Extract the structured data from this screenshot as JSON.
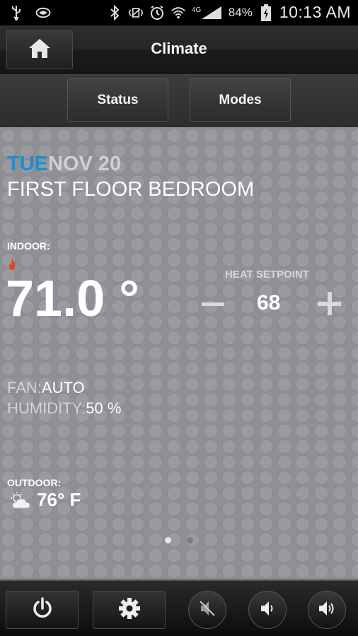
{
  "status_bar": {
    "icons": [
      "usb-icon",
      "sync-icon",
      "bluetooth-icon",
      "vibrate-icon",
      "alarm-icon",
      "wifi-icon",
      "4g-icon",
      "signal-icon"
    ],
    "battery_text": "84%",
    "time": "10:13 AM"
  },
  "header": {
    "title": "Climate",
    "home_icon": "home-icon"
  },
  "tabs": [
    {
      "label": "Status"
    },
    {
      "label": "Modes"
    }
  ],
  "climate": {
    "day": "TUE",
    "date": "NOV 20",
    "room": "FIRST FLOOR BEDROOM",
    "indoor_label": "INDOOR:",
    "indoor_temp": "71.0 °",
    "setpoint_label": "HEAT SETPOINT",
    "setpoint_value": "68",
    "fan_label": "FAN:",
    "fan_value": "AUTO",
    "humidity_label": "HUMIDITY:",
    "humidity_value": "50 %",
    "outdoor_label": "OUTDOOR:",
    "outdoor_temp": "76° F",
    "mode_icon": "flame-icon",
    "weather_icon": "partly-cloudy-icon"
  },
  "pager": {
    "pages": 2,
    "active": 1
  },
  "bottom_bar": {
    "icons": [
      "power-icon",
      "gear-icon",
      "mute-icon",
      "volume-down-icon",
      "volume-up-icon"
    ]
  },
  "colors": {
    "day_accent": "#1b8fd6",
    "panel_bg": "#8e9096",
    "flame": "#e0451c"
  }
}
